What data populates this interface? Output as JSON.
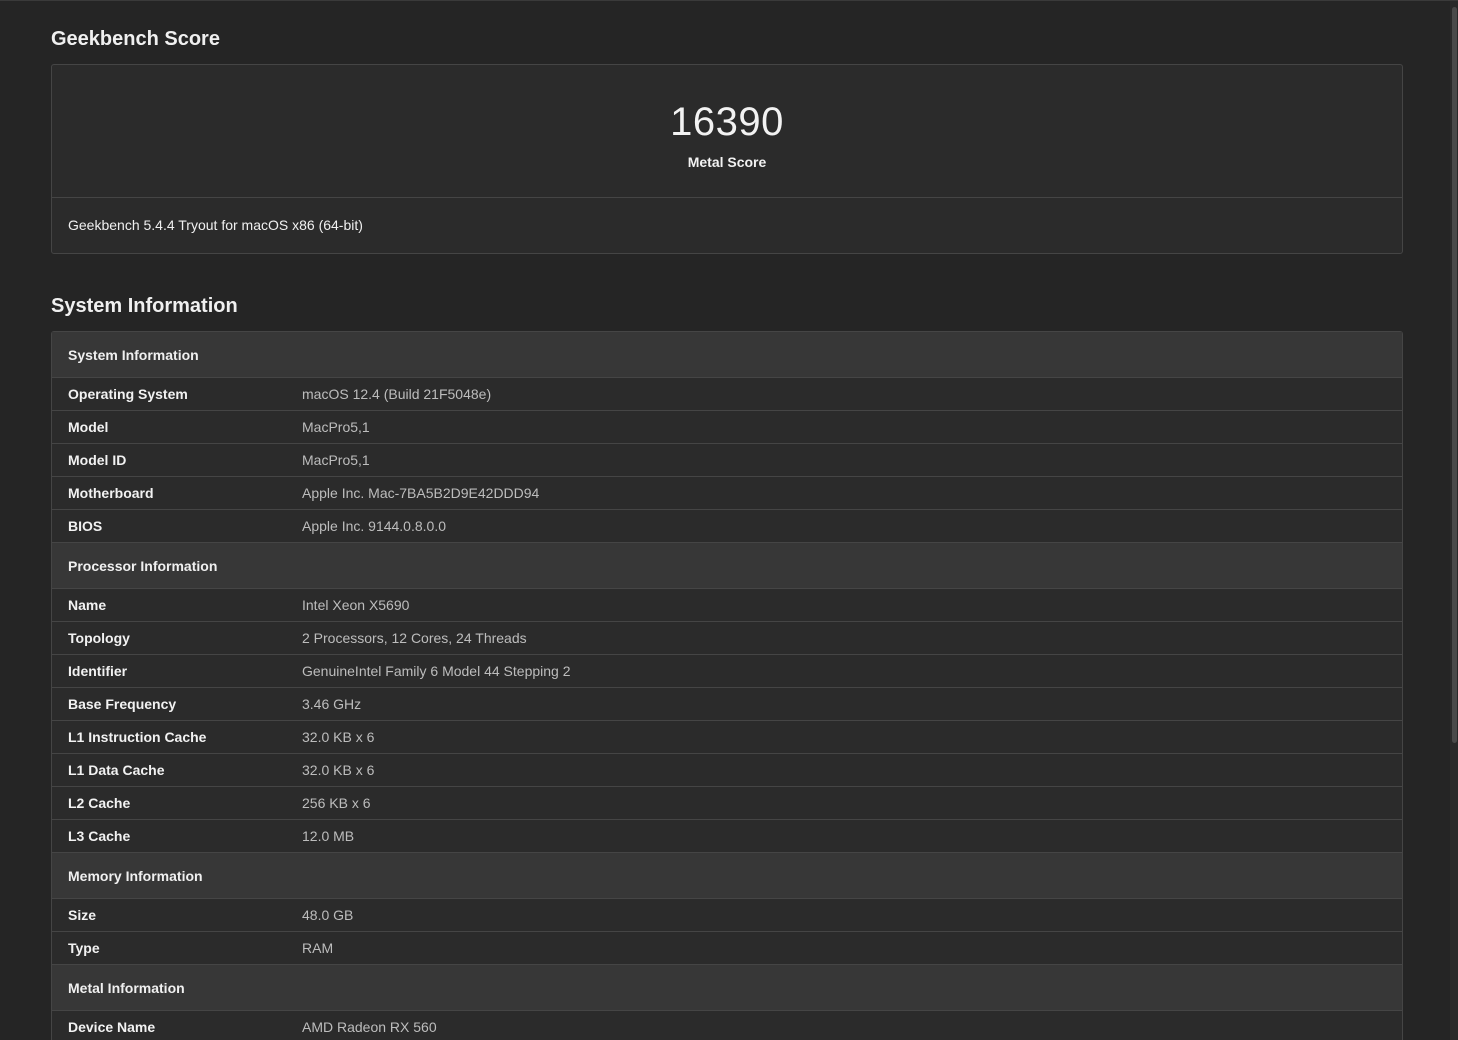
{
  "score_section": {
    "title": "Geekbench Score",
    "score": "16390",
    "score_label": "Metal Score",
    "version": "Geekbench 5.4.4 Tryout for macOS x86 (64-bit)"
  },
  "system_section": {
    "title": "System Information",
    "groups": [
      {
        "header": "System Information",
        "rows": [
          {
            "key": "Operating System",
            "value": "macOS 12.4 (Build 21F5048e)"
          },
          {
            "key": "Model",
            "value": "MacPro5,1"
          },
          {
            "key": "Model ID",
            "value": "MacPro5,1"
          },
          {
            "key": "Motherboard",
            "value": "Apple Inc. Mac-7BA5B2D9E42DDD94"
          },
          {
            "key": "BIOS",
            "value": "Apple Inc. 9144.0.8.0.0"
          }
        ]
      },
      {
        "header": "Processor Information",
        "rows": [
          {
            "key": "Name",
            "value": "Intel Xeon X5690"
          },
          {
            "key": "Topology",
            "value": "2 Processors, 12 Cores, 24 Threads"
          },
          {
            "key": "Identifier",
            "value": "GenuineIntel Family 6 Model 44 Stepping 2"
          },
          {
            "key": "Base Frequency",
            "value": "3.46 GHz"
          },
          {
            "key": "L1 Instruction Cache",
            "value": "32.0 KB x 6"
          },
          {
            "key": "L1 Data Cache",
            "value": "32.0 KB x 6"
          },
          {
            "key": "L2 Cache",
            "value": "256 KB x 6"
          },
          {
            "key": "L3 Cache",
            "value": "12.0 MB"
          }
        ]
      },
      {
        "header": "Memory Information",
        "rows": [
          {
            "key": "Size",
            "value": "48.0 GB"
          },
          {
            "key": "Type",
            "value": "RAM"
          }
        ]
      },
      {
        "header": "Metal Information",
        "rows": [
          {
            "key": "Device Name",
            "value": "AMD Radeon RX 560"
          }
        ]
      }
    ]
  }
}
